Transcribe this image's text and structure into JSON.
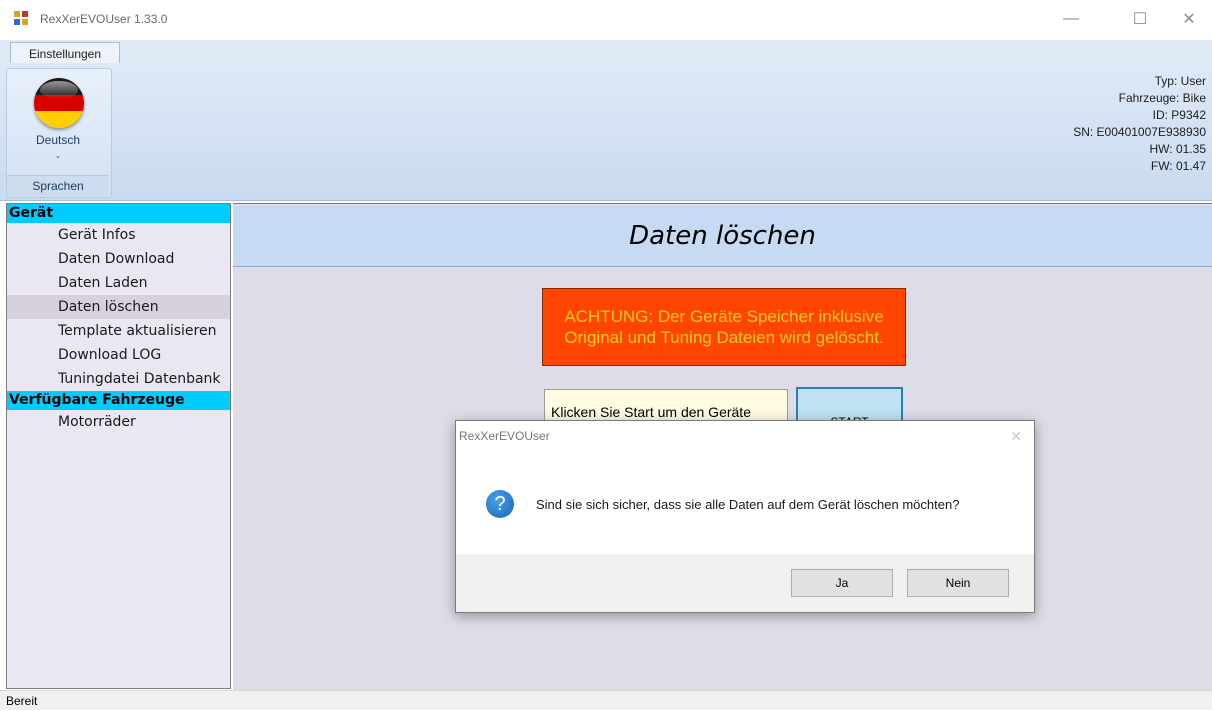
{
  "window": {
    "title": "RexXerEVOUser 1.33.0",
    "minimize": "—",
    "maximize": "☐",
    "close": "✕"
  },
  "ribbon": {
    "tab": "Einstellungen",
    "language": {
      "label": "Deutsch",
      "chevron": "⌄",
      "group_label": "Sprachen"
    }
  },
  "device_info": {
    "typ": "Typ: User",
    "fahrzeuge": "Fahrzeuge: Bike",
    "id": "ID: P9342",
    "sn": "SN: E00401007E938930",
    "hw": "HW: 01.35",
    "fw": "FW: 01.47"
  },
  "nav": {
    "sections": [
      {
        "header": "Gerät",
        "items": [
          "Gerät Infos",
          "Daten Download",
          "Daten Laden",
          "Daten löschen",
          "Template aktualisieren",
          "Download LOG",
          "Tuningdatei Datenbank"
        ]
      },
      {
        "header": "Verfügbare Fahrzeuge",
        "items": [
          "Motorräder"
        ]
      }
    ],
    "selected": "Daten löschen"
  },
  "main": {
    "title": "Daten löschen",
    "warning": "ACHTUNG: Der Geräte Speicher inklusive Original und Tuning Dateien wird gelöscht.",
    "instruction": "Klicken Sie Start um den Geräte",
    "start_button": "START"
  },
  "dialog": {
    "title": "RexXerEVOUser",
    "close": "✕",
    "icon": "?",
    "message": "Sind sie sich sicher, dass sie alle Daten auf dem Gerät löschen möchten?",
    "yes": "Ja",
    "no": "Nein"
  },
  "status": {
    "text": "Bereit"
  },
  "colors": {
    "nav_header": "#00cdfd",
    "warning_bg": "#ff4500",
    "warning_text": "#ffcd1a",
    "main_header": "#c6daf3"
  }
}
